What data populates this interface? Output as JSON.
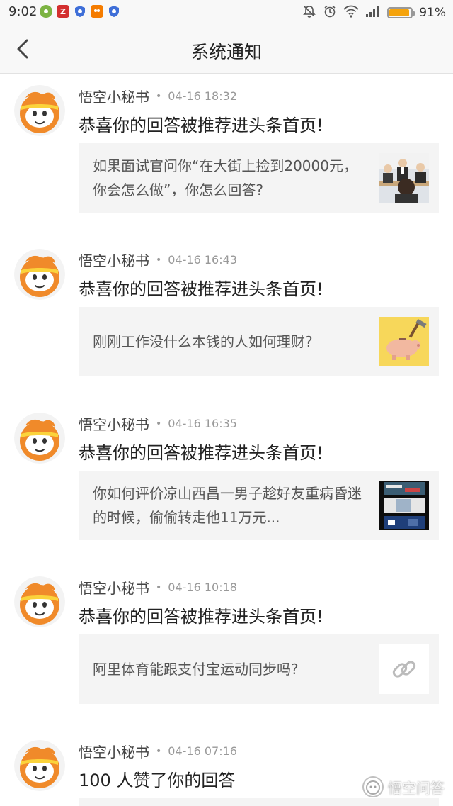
{
  "status_bar": {
    "time": "9:02",
    "battery_percent": "91%",
    "battery_level": 0.91,
    "left_icons": [
      "app-icon-green",
      "app-icon-red",
      "shield-icon",
      "app-icon-orange",
      "shield-icon"
    ],
    "right_icons": [
      "notification-off-icon",
      "alarm-icon",
      "wifi-icon",
      "signal-icon",
      "battery-icon"
    ]
  },
  "header": {
    "title": "系统通知",
    "back_icon": "back-chevron-icon"
  },
  "notifications": [
    {
      "sender": "悟空小秘书",
      "separator": "•",
      "time": "04-16 18:32",
      "message": "恭喜你的回答被推荐进头条首页!",
      "card_text": "如果面试官问你“在大街上捡到20000元，你会怎么做”，你怎么回答?",
      "thumb": "interview-photo"
    },
    {
      "sender": "悟空小秘书",
      "separator": "•",
      "time": "04-16 16:43",
      "message": "恭喜你的回答被推荐进头条首页!",
      "card_text": "刚刚工作没什么本钱的人如何理财?",
      "thumb": "piggy-bank-image"
    },
    {
      "sender": "悟空小秘书",
      "separator": "•",
      "time": "04-16 16:35",
      "message": "恭喜你的回答被推荐进头条首页!",
      "card_text": "你如何评价凉山西昌一男子趁好友重病昏迷的时候，偷偷转走他11万元...",
      "thumb": "news-screenshot"
    },
    {
      "sender": "悟空小秘书",
      "separator": "•",
      "time": "04-16 10:18",
      "message": "恭喜你的回答被推荐进头条首页!",
      "card_text": "阿里体育能跟支付宝运动同步吗?",
      "thumb": "link-icon"
    },
    {
      "sender": "悟空小秘书",
      "separator": "•",
      "time": "04-16 07:16",
      "message": "100 人赞了你的回答",
      "card_text": "",
      "thumb": ""
    }
  ],
  "watermark": {
    "text": "悟空问答"
  },
  "colors": {
    "avatar_orange": "#f08a2a",
    "avatar_yellow": "#fbd33b",
    "card_bg": "#f4f4f4",
    "battery_fill": "#f5a30c"
  }
}
